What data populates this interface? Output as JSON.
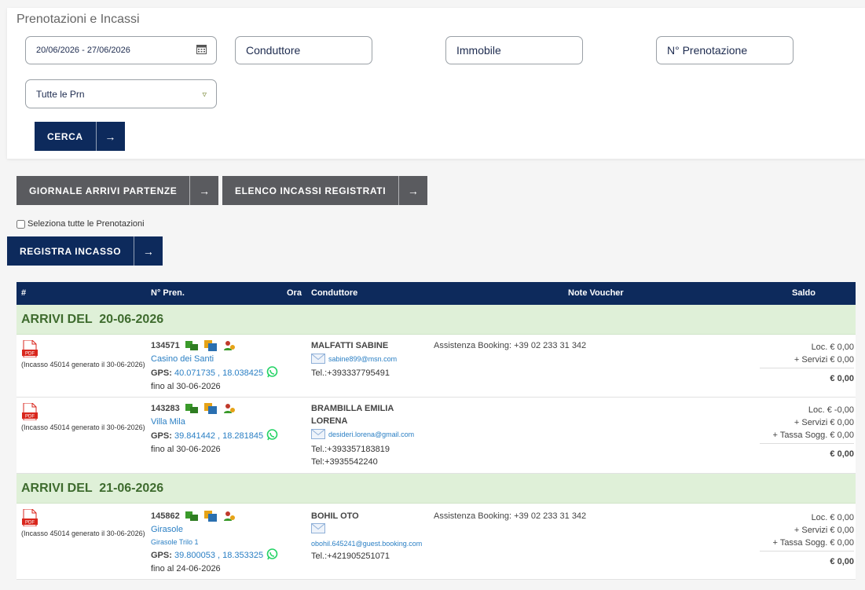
{
  "panel": {
    "title": "Prenotazioni e Incassi",
    "date_range": "20/06/2026 - 27/06/2026",
    "conduttore_placeholder": "Conduttore",
    "immobile_placeholder": "Immobile",
    "nprenotazione_placeholder": "N° Prenotazione",
    "filter_value": "Tutte le Prn",
    "cerca_label": "CERCA"
  },
  "actions": {
    "giornale_label": "GIORNALE ARRIVI PARTENZE",
    "elenco_label": "ELENCO INCASSI REGISTRATI",
    "select_all_label": "Seleziona tutte le Prenotazioni",
    "registra_label": "REGISTRA INCASSO",
    "arrow": "→"
  },
  "table": {
    "headers": {
      "num": "#",
      "npren": "N° Pren.",
      "ora": "Ora",
      "conduttore": "Conduttore",
      "note": "Note Voucher",
      "saldo": "Saldo"
    },
    "groups": [
      {
        "label": "ARRIVI DEL  20-06-2026"
      },
      {
        "label": "ARRIVI DEL  21-06-2026"
      }
    ],
    "rows": [
      {
        "pdf": "PDF",
        "incasso": "(Incasso 45014 generato il 30-06-2026)",
        "pren": "134571",
        "immobile": "Casino dei Santi",
        "gps_label": "GPS:",
        "gps": "40.071735 , 18.038425",
        "fino": "fino al 30-06-2026",
        "conduttore": "MALFATTI SABINE",
        "email": "sabine899@msn.com",
        "tel1": "Tel.:+393337795491",
        "note": "Assistenza Booking: +39 02 233 31 342",
        "loc": "Loc. € 0,00",
        "servizi": "+ Servizi € 0,00",
        "totale": "€ 0,00"
      },
      {
        "pdf": "PDF",
        "incasso": "(Incasso 45014 generato il 30-06-2026)",
        "pren": "143283",
        "immobile": "Villa Mila",
        "gps_label": "GPS:",
        "gps": "39.841442 , 18.281845",
        "fino": "fino al 30-06-2026",
        "conduttore1": "BRAMBILLA EMILIA",
        "conduttore2": "LORENA",
        "email": "desideri.lorena@gmail.com",
        "tel1": "Tel.:+393357183819",
        "tel2": "Tel:+3935542240",
        "loc": "Loc. € -0,00",
        "servizi": "+ Servizi € 0,00",
        "tassa": "+ Tassa Sogg. € 0,00",
        "totale": "€ 0,00"
      },
      {
        "pdf": "PDF",
        "incasso": "(Incasso 45014 generato il 30-06-2026)",
        "pren": "145862",
        "immobile": "Girasole",
        "sub_immobile": "Girasole Trilo 1",
        "gps_label": "GPS:",
        "gps": "39.800053 , 18.353325",
        "fino": "fino al 24-06-2026",
        "conduttore": "BOHIL OTO",
        "email": "obohil.645241@guest.booking.com",
        "tel1": "Tel.:+421905251071",
        "note": "Assistenza Booking: +39 02 233 31 342",
        "loc": "Loc. € 0,00",
        "servizi": "+ Servizi € 0,00",
        "tassa": "+ Tassa Sogg. € 0,00",
        "totale": "€ 0,00"
      }
    ]
  },
  "colors": {
    "navy": "#0d2a5c",
    "gray": "#5a5b5f",
    "group_bg": "#dff0d8",
    "group_text": "#3e6b2e",
    "link": "#2a7fc4",
    "pdf_red": "#d9261c",
    "whatsapp": "#25d366"
  }
}
